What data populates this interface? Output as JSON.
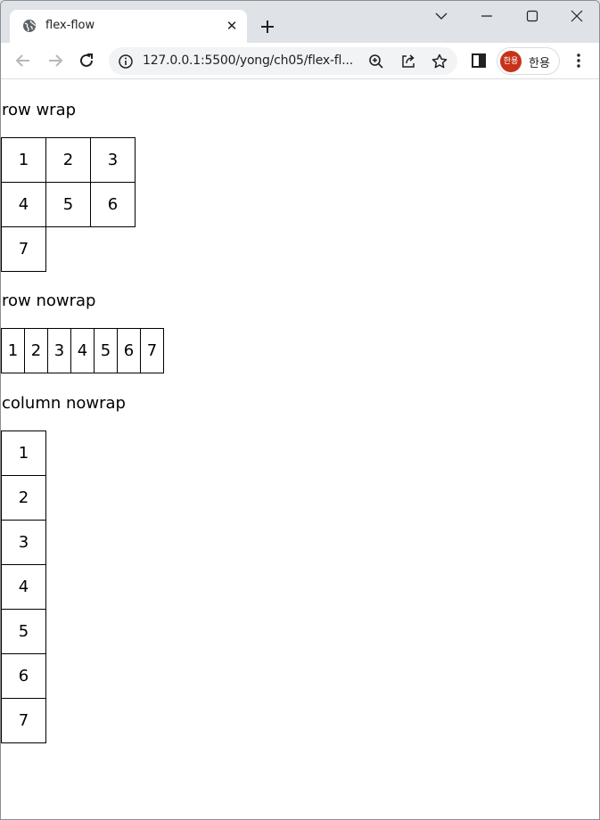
{
  "browser": {
    "tab_title": "flex-flow",
    "tab_close": "✕",
    "url": "127.0.0.1:5500/yong/ch05/flex-fl...",
    "profile_initials": "한용",
    "profile_name": "한용",
    "profile_color": "#c8321a"
  },
  "page": {
    "sections": [
      {
        "heading": "row wrap",
        "items": [
          "1",
          "2",
          "3",
          "4",
          "5",
          "6",
          "7"
        ]
      },
      {
        "heading": "row nowrap",
        "items": [
          "1",
          "2",
          "3",
          "4",
          "5",
          "6",
          "7"
        ]
      },
      {
        "heading": "column nowrap",
        "items": [
          "1",
          "2",
          "3",
          "4",
          "5",
          "6",
          "7"
        ]
      }
    ]
  }
}
